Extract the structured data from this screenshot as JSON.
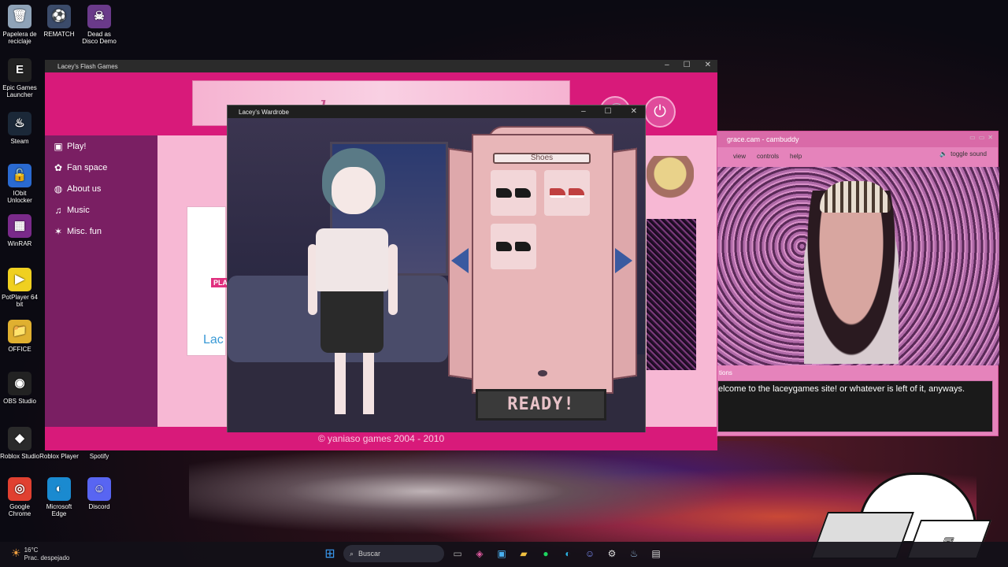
{
  "desktop": {
    "icons": [
      {
        "label": "Papelera de reciclaje",
        "glyph": "🗑",
        "color": "#8fa3b8"
      },
      {
        "label": "REMATCH",
        "glyph": "⚽",
        "color": "#3b4b6a"
      },
      {
        "label": "Dead as Disco Demo",
        "glyph": "☠",
        "color": "#6a3a8a"
      },
      {
        "label": "Epic Games Launcher",
        "glyph": "E",
        "color": "#222"
      },
      {
        "label": "Steam",
        "glyph": "♨",
        "color": "#1b2838"
      },
      {
        "label": "IObit Unlocker",
        "glyph": "🔓",
        "color": "#2a6ad0"
      },
      {
        "label": "WinRAR",
        "glyph": "▦",
        "color": "#7a2a8a"
      },
      {
        "label": "PotPlayer 64 bit",
        "glyph": "▶",
        "color": "#f0d020"
      },
      {
        "label": "OFFICE",
        "glyph": "📁",
        "color": "#e0b030"
      },
      {
        "label": "OBS Studio",
        "glyph": "◉",
        "color": "#222"
      },
      {
        "label": "Roblox Studio",
        "glyph": "◆",
        "color": "#2a2a2a"
      },
      {
        "label": "Roblox Player",
        "glyph": "",
        "color": "transparent"
      },
      {
        "label": "Spotify",
        "glyph": "",
        "color": "transparent"
      },
      {
        "label": "Google Chrome",
        "glyph": "◎",
        "color": "#e04030"
      },
      {
        "label": "Microsoft Edge",
        "glyph": "◐",
        "color": "#1a8ad0"
      },
      {
        "label": "Discord",
        "glyph": "☺",
        "color": "#5865f2"
      }
    ]
  },
  "flash_window": {
    "title": "Lacey's Flash Games",
    "sidebar": [
      {
        "label": "Play!",
        "icon": "gamepad-icon",
        "glyph": "▣"
      },
      {
        "label": "Fan space",
        "icon": "palette-icon",
        "glyph": "✿"
      },
      {
        "label": "About us",
        "icon": "globe-icon",
        "glyph": "◍"
      },
      {
        "label": "Music",
        "icon": "music-icon",
        "glyph": "♫"
      },
      {
        "label": "Misc. fun",
        "icon": "star-icon",
        "glyph": "✶"
      }
    ],
    "banner_text": "lacey games",
    "card_peek_play": "PLA",
    "card_peek_name": "Lac",
    "footer": "© yaniaso games 2004 - 2010"
  },
  "wardrobe_window": {
    "title": "Lacey's Wardrobe",
    "category_label": "Shoes",
    "ready_label": "READY!"
  },
  "cam_window": {
    "title": "grace.cam - cambuddy",
    "menu": [
      "view",
      "controls",
      "help"
    ],
    "toggle_sound": "toggle sound",
    "options_label": "tions",
    "message": "elcome to the laceygames site! or whatever is left of it, anyways."
  },
  "taskbar": {
    "temperature": "16°C",
    "weather": "Prac. despejado",
    "search_placeholder": "Buscar"
  },
  "colors": {
    "flash_accent": "#d81a7a",
    "sidebar": "#7a1f63",
    "cam_frame": "#e583bb"
  }
}
